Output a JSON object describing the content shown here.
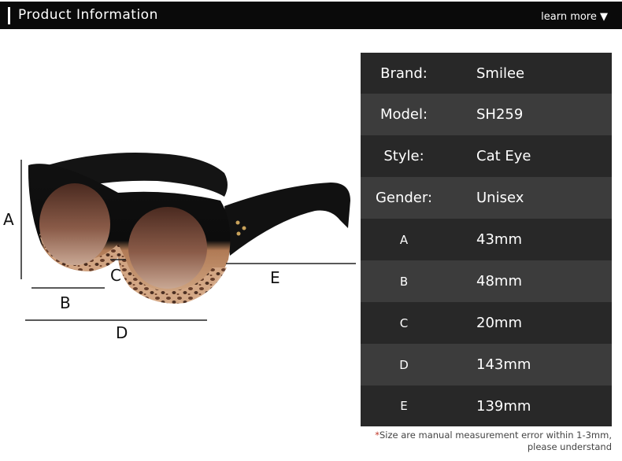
{
  "header": {
    "title": "Product Information",
    "more": "learn more ▼"
  },
  "specs": [
    {
      "label": "Brand:",
      "value": "Smilee"
    },
    {
      "label": "Model:",
      "value": "SH259"
    },
    {
      "label": "Style:",
      "value": "Cat Eye"
    },
    {
      "label": "Gender:",
      "value": "Unisex"
    },
    {
      "label": "A",
      "value": "43mm"
    },
    {
      "label": "B",
      "value": "48mm"
    },
    {
      "label": "C",
      "value": "20mm"
    },
    {
      "label": "D",
      "value": "143mm"
    },
    {
      "label": "E",
      "value": "139mm"
    }
  ],
  "dimensions": {
    "a": "A",
    "b": "B",
    "c": "C",
    "d": "D",
    "e": "E"
  },
  "note": {
    "star": "*",
    "line1": "Size are manual measurement error within 1-3mm,",
    "line2": "please understand"
  }
}
